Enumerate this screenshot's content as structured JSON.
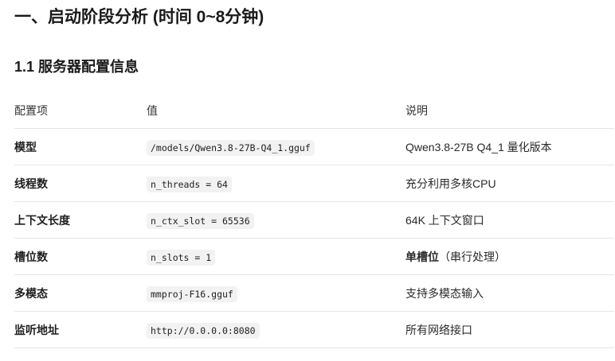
{
  "heading": "一、启动阶段分析 (时间 0~8分钟)",
  "subheading": "1.1 服务器配置信息",
  "table": {
    "headers": [
      "配置项",
      "值",
      "说明"
    ],
    "rows": [
      {
        "key": "模型",
        "value": "/models/Qwen3.8-27B-Q4_1.gguf",
        "desc": "Qwen3.8-27B Q4_1 量化版本"
      },
      {
        "key": "线程数",
        "value": "n_threads = 64",
        "desc": "充分利用多核CPU"
      },
      {
        "key": "上下文长度",
        "value": "n_ctx_slot = 65536",
        "desc": "64K 上下文窗口"
      },
      {
        "key": "槽位数",
        "value": "n_slots = 1",
        "desc_bold": "单槽位",
        "desc_rest": "（串行处理）"
      },
      {
        "key": "多模态",
        "value": "mmproj-F16.gguf",
        "desc": "支持多模态输入"
      },
      {
        "key": "监听地址",
        "value": "http://0.0.0.0:8080",
        "desc": "所有网络接口"
      }
    ]
  }
}
